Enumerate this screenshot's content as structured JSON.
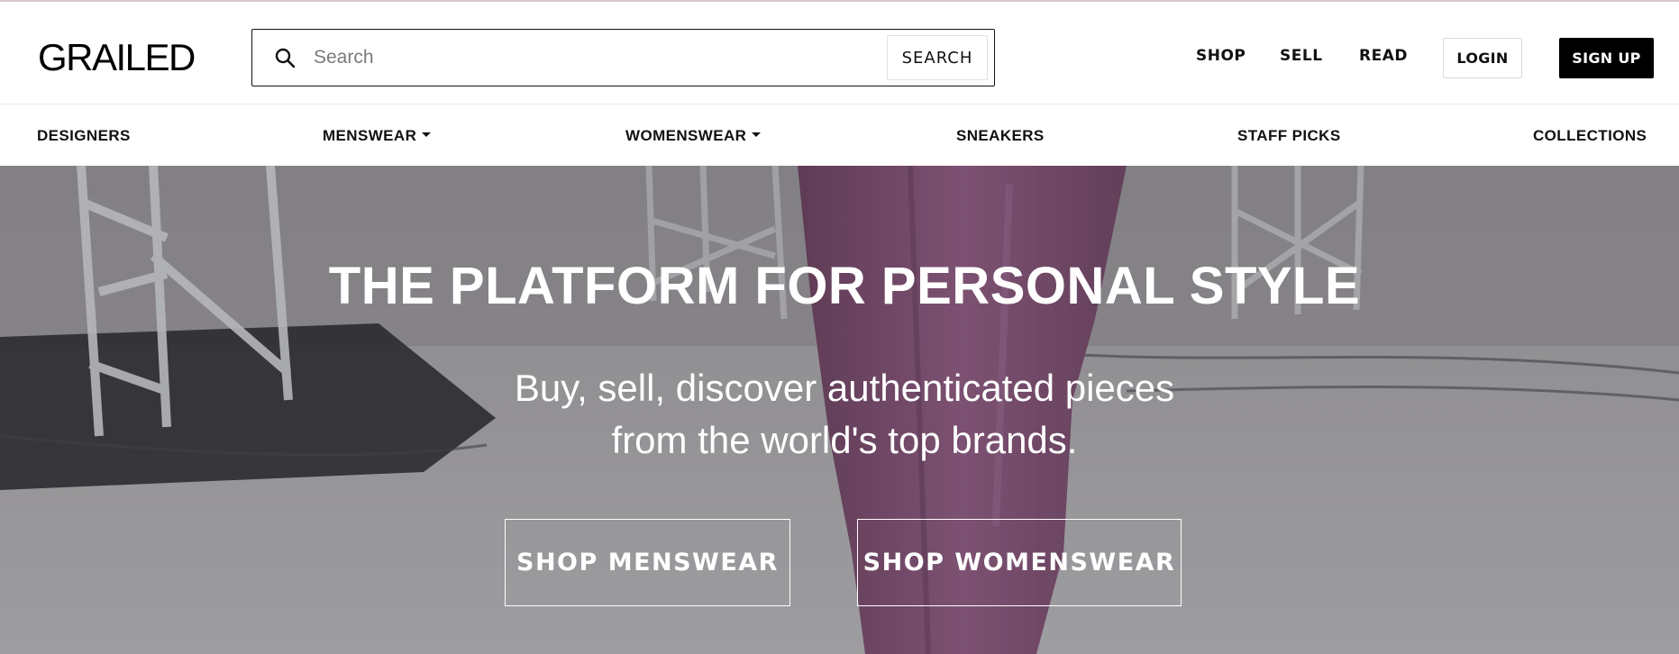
{
  "brand": {
    "logo_text": "GRAILED"
  },
  "search": {
    "placeholder": "Search",
    "button_label": "SEARCH"
  },
  "header_nav": {
    "shop": "SHOP",
    "sell": "SELL",
    "read": "READ",
    "login": "LOGIN",
    "signup": "SIGN UP"
  },
  "categories": [
    {
      "label": "DESIGNERS",
      "has_dropdown": false
    },
    {
      "label": "MENSWEAR",
      "has_dropdown": true
    },
    {
      "label": "WOMENSWEAR",
      "has_dropdown": true
    },
    {
      "label": "SNEAKERS",
      "has_dropdown": false
    },
    {
      "label": "STAFF PICKS",
      "has_dropdown": false
    },
    {
      "label": "COLLECTIONS",
      "has_dropdown": false
    }
  ],
  "hero": {
    "title": "THE PLATFORM FOR PERSONAL STYLE",
    "subtitle_line1": "Buy, sell, discover authenticated pieces",
    "subtitle_line2": "from the world's top brands.",
    "cta_menswear": "SHOP MENSWEAR",
    "cta_womenswear": "SHOP WOMENSWEAR"
  },
  "colors": {
    "accent": "#000000",
    "hero_garment": "#8a5a7e",
    "hero_background": "#a3a1a4"
  },
  "icons": {
    "search": "search-icon",
    "dropdown": "caret-down-icon"
  }
}
